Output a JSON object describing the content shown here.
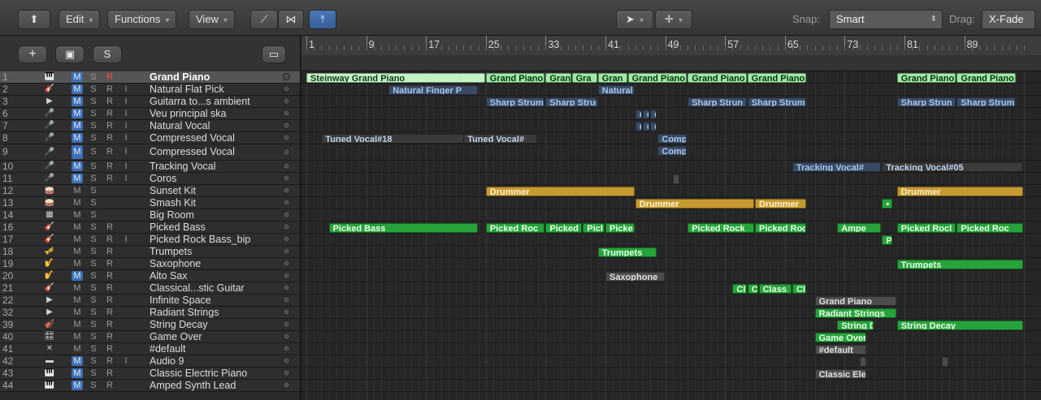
{
  "toolbar": {
    "edit": "Edit",
    "functions": "Functions",
    "view": "View",
    "snap_label": "Snap:",
    "snap_value": "Smart",
    "drag_label": "Drag:",
    "drag_value": "X-Fade",
    "caret": "▾",
    "updown": "⬍"
  },
  "header_buttons": {
    "add": "+",
    "global": "▣",
    "s": "S",
    "collapse": "▭"
  },
  "ruler": {
    "bars": [
      "1",
      "9",
      "17",
      "25",
      "33",
      "41",
      "49",
      "57",
      "65",
      "73",
      "81",
      "89"
    ]
  },
  "tracks": [
    {
      "num": "1",
      "icon": "🎹",
      "m": "M",
      "s": "S",
      "r": "R",
      "i": "",
      "name": "Grand Piano",
      "selected": true,
      "m_on": true,
      "r_on": true
    },
    {
      "num": "2",
      "icon": "🎸",
      "m": "M",
      "s": "S",
      "r": "R",
      "i": "I",
      "name": "Natural Flat Pick",
      "m_on": true
    },
    {
      "num": "3",
      "icon": "▶",
      "m": "M",
      "s": "S",
      "r": "R",
      "i": "I",
      "name": "Guitarra to...s ambient",
      "m_on": true
    },
    {
      "num": "6",
      "icon": "🎤",
      "m": "M",
      "s": "S",
      "r": "R",
      "i": "I",
      "name": "Veu principal ska",
      "m_on": true
    },
    {
      "num": "7",
      "icon": "🎤",
      "m": "M",
      "s": "S",
      "r": "R",
      "i": "I",
      "name": "Natural Vocal",
      "m_on": true
    },
    {
      "num": "8",
      "icon": "🎤",
      "m": "M",
      "s": "S",
      "r": "R",
      "i": "I",
      "name": "Compressed Vocal",
      "m_on": true
    },
    {
      "num": "9",
      "icon": "🎤",
      "m": "M",
      "s": "S",
      "r": "R",
      "i": "I",
      "name": "Compressed Vocal",
      "m_on": true
    },
    {
      "num": "10",
      "icon": "🎤",
      "m": "M",
      "s": "S",
      "r": "R",
      "i": "I",
      "name": "Tracking Vocal",
      "m_on": true
    },
    {
      "num": "11",
      "icon": "🎤",
      "m": "M",
      "s": "S",
      "r": "R",
      "i": "I",
      "name": "Coros",
      "m_on": true
    },
    {
      "num": "12",
      "icon": "🥁",
      "m": "M",
      "s": "S",
      "r": "",
      "i": "",
      "name": "Sunset Kit"
    },
    {
      "num": "13",
      "icon": "🥁",
      "m": "M",
      "s": "S",
      "r": "",
      "i": "",
      "name": "Smash Kit"
    },
    {
      "num": "14",
      "icon": "▦",
      "m": "M",
      "s": "S",
      "r": "",
      "i": "",
      "name": "Big Room"
    },
    {
      "num": "16",
      "icon": "🎸",
      "m": "M",
      "s": "S",
      "r": "R",
      "i": "",
      "name": "Picked Bass"
    },
    {
      "num": "17",
      "icon": "🎸",
      "m": "M",
      "s": "S",
      "r": "R",
      "i": "I",
      "name": "Picked Rock Bass_bip"
    },
    {
      "num": "18",
      "icon": "🎺",
      "m": "M",
      "s": "S",
      "r": "R",
      "i": "",
      "name": "Trumpets"
    },
    {
      "num": "19",
      "icon": "🎷",
      "m": "M",
      "s": "S",
      "r": "R",
      "i": "",
      "name": "Saxophone"
    },
    {
      "num": "20",
      "icon": "🎷",
      "m": "M",
      "s": "S",
      "r": "R",
      "i": "",
      "name": "Alto Sax",
      "m_on": true
    },
    {
      "num": "21",
      "icon": "🎸",
      "m": "M",
      "s": "S",
      "r": "R",
      "i": "",
      "name": "Classical...stic Guitar"
    },
    {
      "num": "22",
      "icon": "▶",
      "m": "M",
      "s": "S",
      "r": "R",
      "i": "",
      "name": "Infinite Space"
    },
    {
      "num": "32",
      "icon": "▶",
      "m": "M",
      "s": "S",
      "r": "R",
      "i": "",
      "name": "Radiant Strings"
    },
    {
      "num": "39",
      "icon": "🎻",
      "m": "M",
      "s": "S",
      "r": "R",
      "i": "",
      "name": "String Decay"
    },
    {
      "num": "40",
      "icon": "🎛",
      "m": "M",
      "s": "S",
      "r": "R",
      "i": "",
      "name": "Game Over"
    },
    {
      "num": "41",
      "icon": "✕",
      "m": "M",
      "s": "S",
      "r": "R",
      "i": "",
      "name": "#default"
    },
    {
      "num": "42",
      "icon": "▬",
      "m": "M",
      "s": "S",
      "r": "R",
      "i": "I",
      "name": "Audio 9",
      "m_on": true
    },
    {
      "num": "43",
      "icon": "🎹",
      "m": "M",
      "s": "S",
      "r": "R",
      "i": "",
      "name": "Classic Electric Piano",
      "m_on": true
    },
    {
      "num": "44",
      "icon": "🎹",
      "m": "M",
      "s": "S",
      "r": "R",
      "i": "",
      "name": "Amped Synth Lead",
      "m_on": true
    }
  ],
  "regions": [
    {
      "lane": 0,
      "bar": 1,
      "len": 24,
      "label": "Steinway Grand Piano",
      "style": "r-piano"
    },
    {
      "lane": 0,
      "bar": 25,
      "len": 8,
      "label": "Grand Piano",
      "style": "r-piano2"
    },
    {
      "lane": 0,
      "bar": 33,
      "len": 3.5,
      "label": "Grand I",
      "style": "r-piano2"
    },
    {
      "lane": 0,
      "bar": 36.5,
      "len": 3.5,
      "label": "Gra",
      "style": "r-piano2"
    },
    {
      "lane": 0,
      "bar": 40,
      "len": 4,
      "label": "Gran",
      "style": "r-piano2"
    },
    {
      "lane": 0,
      "bar": 44,
      "len": 8,
      "label": "Grand Piano",
      "style": "r-piano2"
    },
    {
      "lane": 0,
      "bar": 52,
      "len": 8,
      "label": "Grand Piano",
      "style": "r-piano2"
    },
    {
      "lane": 0,
      "bar": 60,
      "len": 8,
      "label": "Grand Piano",
      "style": "r-piano2"
    },
    {
      "lane": 0,
      "bar": 80,
      "len": 8,
      "label": "Grand Piano",
      "style": "r-piano2"
    },
    {
      "lane": 0,
      "bar": 88,
      "len": 8,
      "label": "Grand Piano",
      "style": "r-piano2"
    },
    {
      "lane": 1,
      "bar": 12,
      "len": 12,
      "label": "Natural Finger P",
      "style": "r-blue"
    },
    {
      "lane": 1,
      "bar": 40,
      "len": 5,
      "label": "Natural",
      "style": "r-blue"
    },
    {
      "lane": 2,
      "bar": 25,
      "len": 8,
      "label": "Sharp Strum",
      "style": "r-blue"
    },
    {
      "lane": 2,
      "bar": 33,
      "len": 7,
      "label": "Sharp Strun",
      "style": "r-blue"
    },
    {
      "lane": 2,
      "bar": 52,
      "len": 8,
      "label": "Sharp Strun",
      "style": "r-blue"
    },
    {
      "lane": 2,
      "bar": 60,
      "len": 8,
      "label": "Sharp Strum",
      "style": "r-blue"
    },
    {
      "lane": 2,
      "bar": 80,
      "len": 8,
      "label": "Sharp Strun",
      "style": "r-blue"
    },
    {
      "lane": 2,
      "bar": 88,
      "len": 8,
      "label": "Sharp Strum",
      "style": "r-blue"
    },
    {
      "lane": 3,
      "bar": 45,
      "len": 1,
      "label": "C",
      "style": "r-blue"
    },
    {
      "lane": 3,
      "bar": 46,
      "len": 1,
      "label": "C",
      "style": "r-blue"
    },
    {
      "lane": 3,
      "bar": 47,
      "len": 1,
      "label": "C",
      "style": "r-blue"
    },
    {
      "lane": 4,
      "bar": 45,
      "len": 1,
      "label": "C",
      "style": "r-blue"
    },
    {
      "lane": 4,
      "bar": 46,
      "len": 1,
      "label": "C",
      "style": "r-blue"
    },
    {
      "lane": 4,
      "bar": 47,
      "len": 1,
      "label": "C",
      "style": "r-blue"
    },
    {
      "lane": 5,
      "bar": 3,
      "len": 20,
      "label": "Tuned Vocal#18",
      "style": "r-dark"
    },
    {
      "lane": 5,
      "bar": 22,
      "len": 10,
      "label": "Tuned Vocal#",
      "style": "r-dark"
    },
    {
      "lane": 5,
      "bar": 48,
      "len": 4,
      "label": "Comp",
      "style": "r-blue"
    },
    {
      "lane": 6,
      "bar": 48,
      "len": 4,
      "label": "Comp",
      "style": "r-blue"
    },
    {
      "lane": 7,
      "bar": 66,
      "len": 12,
      "label": "Tracking Vocal#",
      "style": "r-blue"
    },
    {
      "lane": 7,
      "bar": 78,
      "len": 19,
      "label": "Tracking Vocal#05",
      "style": "r-dark"
    },
    {
      "lane": 8,
      "bar": 50,
      "len": 1,
      "label": "",
      "style": "r-gray"
    },
    {
      "lane": 9,
      "bar": 25,
      "len": 20,
      "label": "Drummer",
      "style": "r-gold"
    },
    {
      "lane": 9,
      "bar": 80,
      "len": 17,
      "label": "Drummer",
      "style": "r-gold"
    },
    {
      "lane": 10,
      "bar": 45,
      "len": 16,
      "label": "Drummer",
      "style": "r-gold"
    },
    {
      "lane": 10,
      "bar": 61,
      "len": 7,
      "label": "Drummer",
      "style": "r-gold"
    },
    {
      "lane": 10,
      "bar": 78,
      "len": 1.5,
      "label": "•",
      "style": "r-green"
    },
    {
      "lane": 12,
      "bar": 4,
      "len": 20,
      "label": "Picked Bass",
      "style": "r-green"
    },
    {
      "lane": 12,
      "bar": 25,
      "len": 8,
      "label": "Picked Roc",
      "style": "r-green"
    },
    {
      "lane": 12,
      "bar": 33,
      "len": 5,
      "label": "Picked",
      "style": "r-green"
    },
    {
      "lane": 12,
      "bar": 38,
      "len": 3,
      "label": "Picl",
      "style": "r-green"
    },
    {
      "lane": 12,
      "bar": 41,
      "len": 4,
      "label": "Picke",
      "style": "r-green"
    },
    {
      "lane": 12,
      "bar": 52,
      "len": 9,
      "label": "Picked Rock",
      "style": "r-green"
    },
    {
      "lane": 12,
      "bar": 61,
      "len": 7,
      "label": "Picked Roc",
      "style": "r-green"
    },
    {
      "lane": 12,
      "bar": 72,
      "len": 6,
      "label": "Ampe",
      "style": "r-green"
    },
    {
      "lane": 12,
      "bar": 80,
      "len": 8,
      "label": "Picked Rocl",
      "style": "r-green"
    },
    {
      "lane": 12,
      "bar": 88,
      "len": 9,
      "label": "Picked Roc",
      "style": "r-green"
    },
    {
      "lane": 13,
      "bar": 78,
      "len": 1.5,
      "label": "P",
      "style": "r-green"
    },
    {
      "lane": 14,
      "bar": 40,
      "len": 8,
      "label": "Trumpets",
      "style": "r-green"
    },
    {
      "lane": 15,
      "bar": 80,
      "len": 17,
      "label": "Trumpets",
      "style": "r-green"
    },
    {
      "lane": 16,
      "bar": 41,
      "len": 8,
      "label": "Saxophone",
      "style": "r-gray"
    },
    {
      "lane": 17,
      "bar": 58,
      "len": 2,
      "label": "Cl",
      "style": "r-green"
    },
    {
      "lane": 17,
      "bar": 60,
      "len": 1.5,
      "label": "C",
      "style": "r-green"
    },
    {
      "lane": 17,
      "bar": 61.5,
      "len": 4.5,
      "label": "Class",
      "style": "r-green"
    },
    {
      "lane": 17,
      "bar": 66,
      "len": 2,
      "label": "Cl",
      "style": "r-green"
    },
    {
      "lane": 18,
      "bar": 69,
      "len": 11,
      "label": "Grand Piano",
      "style": "r-gray"
    },
    {
      "lane": 19,
      "bar": 69,
      "len": 11,
      "label": "Radiant Strings",
      "style": "r-green"
    },
    {
      "lane": 20,
      "bar": 72,
      "len": 5,
      "label": "String D",
      "style": "r-green"
    },
    {
      "lane": 20,
      "bar": 80,
      "len": 17,
      "label": "String Decay",
      "style": "r-green"
    },
    {
      "lane": 21,
      "bar": 69,
      "len": 7,
      "label": "Game Over",
      "style": "r-green"
    },
    {
      "lane": 22,
      "bar": 69,
      "len": 7,
      "label": "#default",
      "style": "r-gray"
    },
    {
      "lane": 23,
      "bar": 75,
      "len": 1,
      "label": "",
      "style": "r-gray"
    },
    {
      "lane": 23,
      "bar": 86,
      "len": 1,
      "label": "",
      "style": "r-gray"
    },
    {
      "lane": 24,
      "bar": 69,
      "len": 7,
      "label": "Classic Elec",
      "style": "r-gray"
    }
  ]
}
